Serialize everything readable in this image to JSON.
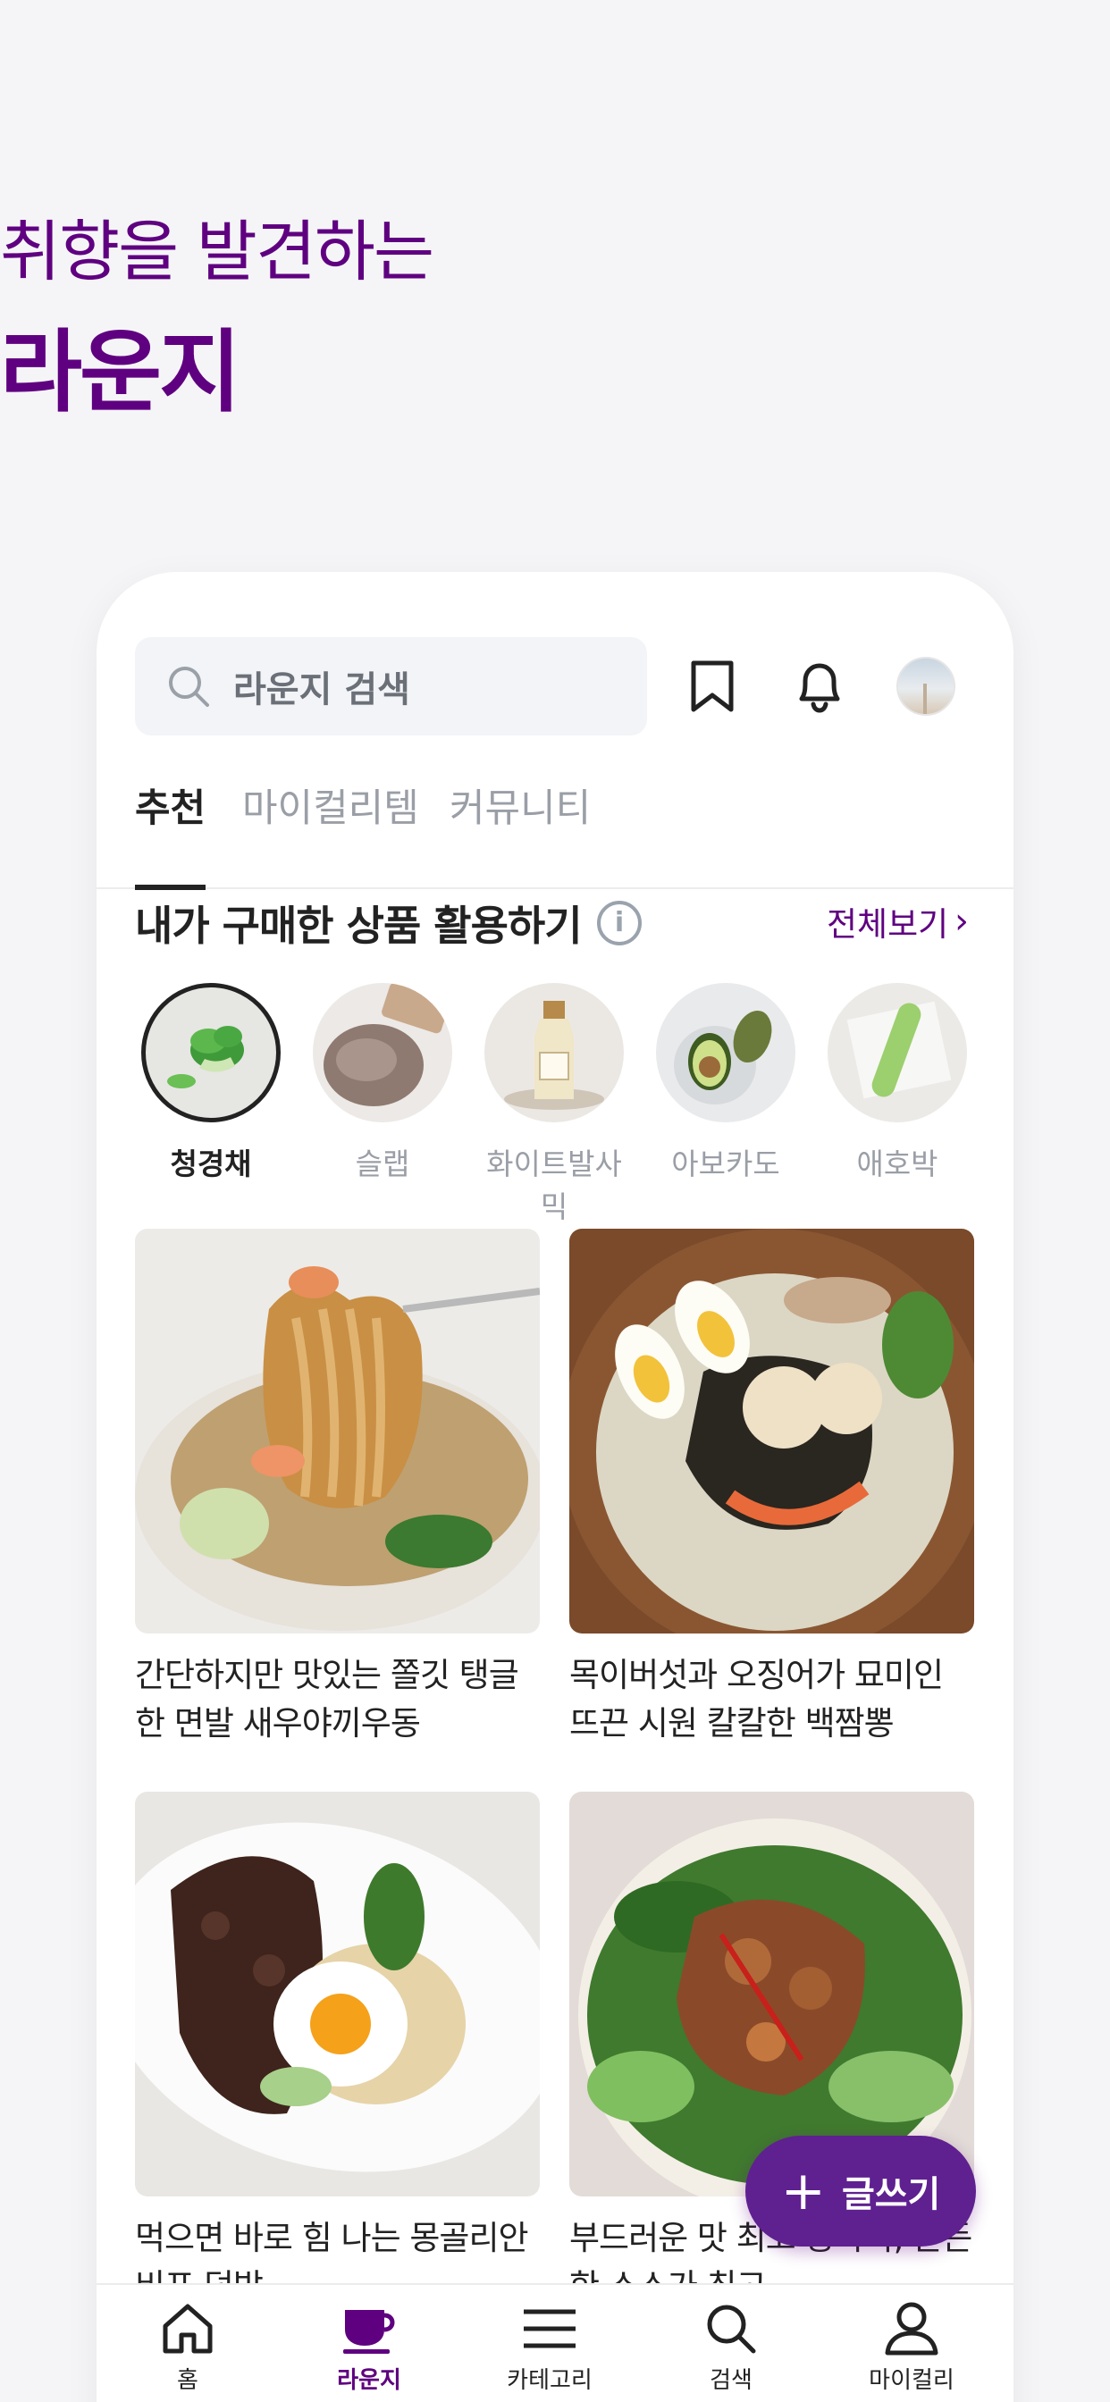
{
  "promo": {
    "subtitle": "취향을 발견하는",
    "title": "라운지"
  },
  "header": {
    "search_placeholder": "라운지 검색",
    "icons": [
      "search-icon",
      "bookmark-icon",
      "bell-icon",
      "avatar"
    ]
  },
  "tabs": [
    {
      "label": "추천",
      "active": true
    },
    {
      "label": "마이컬리템",
      "active": false
    },
    {
      "label": "커뮤니티",
      "active": false
    }
  ],
  "section": {
    "title": "내가 구매한 상품 활용하기",
    "see_all": "전체보기"
  },
  "chips": [
    {
      "label": "청경채",
      "active": true
    },
    {
      "label": "슬랩",
      "active": false
    },
    {
      "label": "화이트발사믹",
      "active": false
    },
    {
      "label": "아보카도",
      "active": false
    },
    {
      "label": "애호박",
      "active": false
    }
  ],
  "cards": [
    {
      "title": "간단하지만 맛있는 쫄깃 탱글 한 면발 새우야끼우동"
    },
    {
      "title": "목이버섯과 오징어가 묘미인 뜨끈 시원 칼칼한 백짬뽕"
    },
    {
      "title": "먹으면 바로 힘 나는 몽골리안 비프 덮밥"
    },
    {
      "title": "부드러운 맛 최고 동파육, 든든한 소스가 최고"
    }
  ],
  "fab": {
    "label": "글쓰기"
  },
  "nav": [
    {
      "label": "홈",
      "active": false
    },
    {
      "label": "라운지",
      "active": true
    },
    {
      "label": "카테고리",
      "active": false
    },
    {
      "label": "검색",
      "active": false
    },
    {
      "label": "마이컬리",
      "active": false
    }
  ],
  "colors": {
    "brand": "#5f0080",
    "text": "#222222",
    "muted": "#9a9ea6"
  }
}
